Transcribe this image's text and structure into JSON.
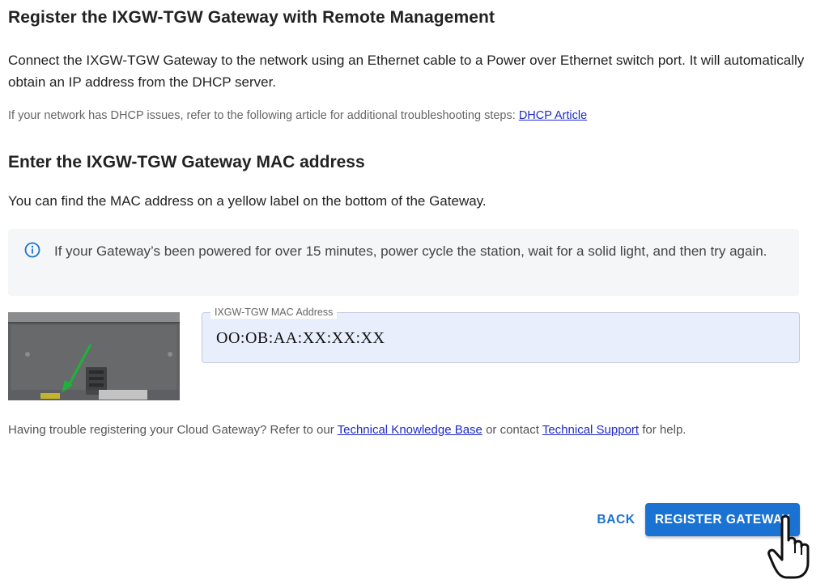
{
  "header": {
    "title": "Register the IXGW-TGW Gateway with Remote Management",
    "description": "Connect the IXGW-TGW Gateway to the network using an Ethernet cable to a Power over Ethernet switch port. It will automatically obtain an IP address from the DHCP server.",
    "dhcp_note": "If your network has DHCP issues, refer to the following article for additional troubleshooting steps: ",
    "dhcp_link": "DHCP Article"
  },
  "mac_section": {
    "title": "Enter the IXGW-TGW Gateway MAC address",
    "description": "You can find the MAC address on a yellow label on the bottom of the Gateway.",
    "info_text": "If your Gateway’s been powered for over 15 minutes, power cycle the station, wait for a solid light, and then try again.",
    "field_label": "IXGW-TGW MAC Address",
    "field_value": "OO:OB:AA:XX:XX:XX"
  },
  "help": {
    "prefix": "Having trouble registering your Cloud Gateway? Refer to our ",
    "kb_link": "Technical Knowledge Base",
    "middle": " or contact ",
    "support_link": "Technical Support",
    "suffix": " for help."
  },
  "actions": {
    "back_label": "BACK",
    "register_label": "REGISTER GATEWAY"
  },
  "icons": {
    "info": "info-circle-icon",
    "cursor": "hand-pointer-icon"
  },
  "colors": {
    "primary": "#1a73d2",
    "link": "#1f2bc8",
    "field_bg": "#e8eefc",
    "info_bg": "#f5f6f7"
  }
}
